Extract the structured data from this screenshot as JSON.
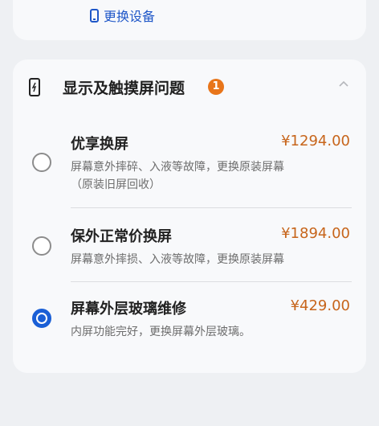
{
  "top_card": {
    "change_device_label": "更换设备"
  },
  "issue_section": {
    "title": "显示及触摸屏问题",
    "badge_count": "1",
    "options": [
      {
        "title": "优享换屏",
        "price": "¥1294.00",
        "desc_line1": "屏幕意外摔碎、入液等故障，更换原装屏幕",
        "desc_line2": "（原装旧屏回收）",
        "selected": false
      },
      {
        "title": "保外正常价换屏",
        "price": "¥1894.00",
        "desc_line1": "屏幕意外摔损、入液等故障，更换原装屏幕",
        "selected": false
      },
      {
        "title": "屏幕外层玻璃维修",
        "price": "¥429.00",
        "desc_line1": "内屏功能完好，更换屏幕外层玻璃。",
        "selected": true
      }
    ]
  },
  "colors": {
    "accent_blue": "#1a5fd6",
    "price_orange": "#c7651b",
    "badge_orange": "#e8751a"
  },
  "icons": [
    "phone-icon",
    "chevron-up-icon",
    "device-icon"
  ]
}
